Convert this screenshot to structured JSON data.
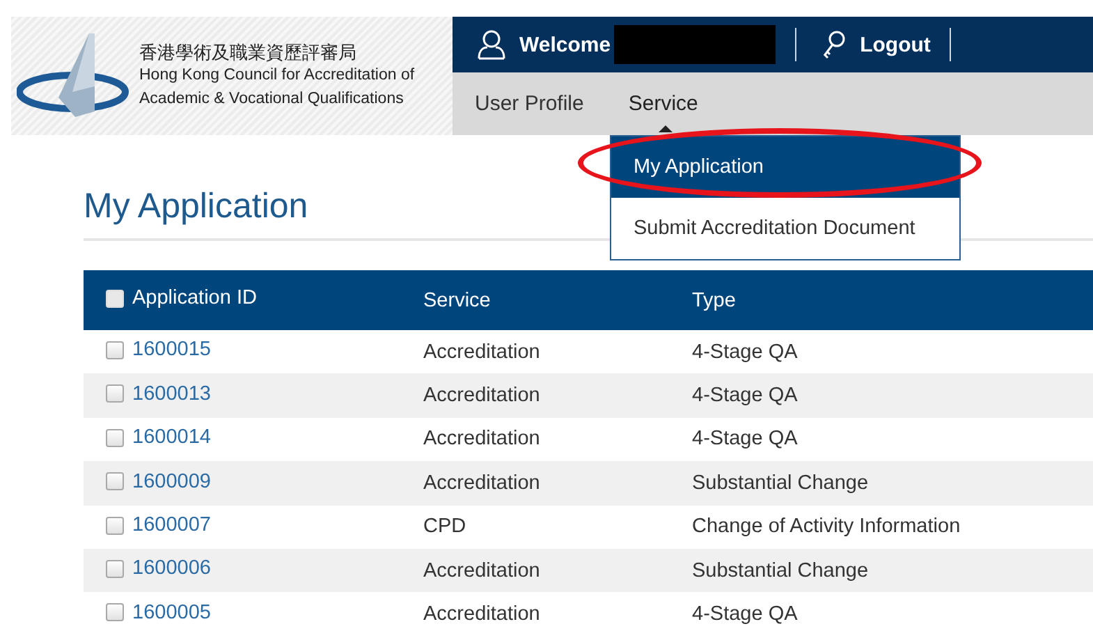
{
  "logo": {
    "name_zh": "香港學術及職業資歷評審局",
    "name_en_1": "Hong Kong Council for Accreditation of",
    "name_en_2": "Academic & Vocational Qualifications"
  },
  "top_bar": {
    "welcome": "Welcome",
    "logout": "Logout"
  },
  "nav": {
    "items": [
      {
        "label": "User Profile",
        "expanded": false
      },
      {
        "label": "Service",
        "expanded": true
      }
    ]
  },
  "dropdown": {
    "items": [
      {
        "label": "My Application",
        "selected": true
      },
      {
        "label": "Submit Accreditation Document",
        "selected": false
      }
    ]
  },
  "page_title": "My Application",
  "table": {
    "select_all_checked": false,
    "columns": [
      "Application ID",
      "Service",
      "Type"
    ],
    "rows": [
      {
        "checked": false,
        "id": "1600015",
        "service": "Accreditation",
        "type": "4-Stage QA"
      },
      {
        "checked": false,
        "id": "1600013",
        "service": "Accreditation",
        "type": "4-Stage QA"
      },
      {
        "checked": false,
        "id": "1600014",
        "service": "Accreditation",
        "type": "4-Stage QA"
      },
      {
        "checked": false,
        "id": "1600009",
        "service": "Accreditation",
        "type": "Substantial Change"
      },
      {
        "checked": false,
        "id": "1600007",
        "service": "CPD",
        "type": "Change of Activity Information"
      },
      {
        "checked": false,
        "id": "1600006",
        "service": "Accreditation",
        "type": "Substantial Change"
      },
      {
        "checked": false,
        "id": "1600005",
        "service": "Accreditation",
        "type": "4-Stage QA"
      }
    ]
  }
}
